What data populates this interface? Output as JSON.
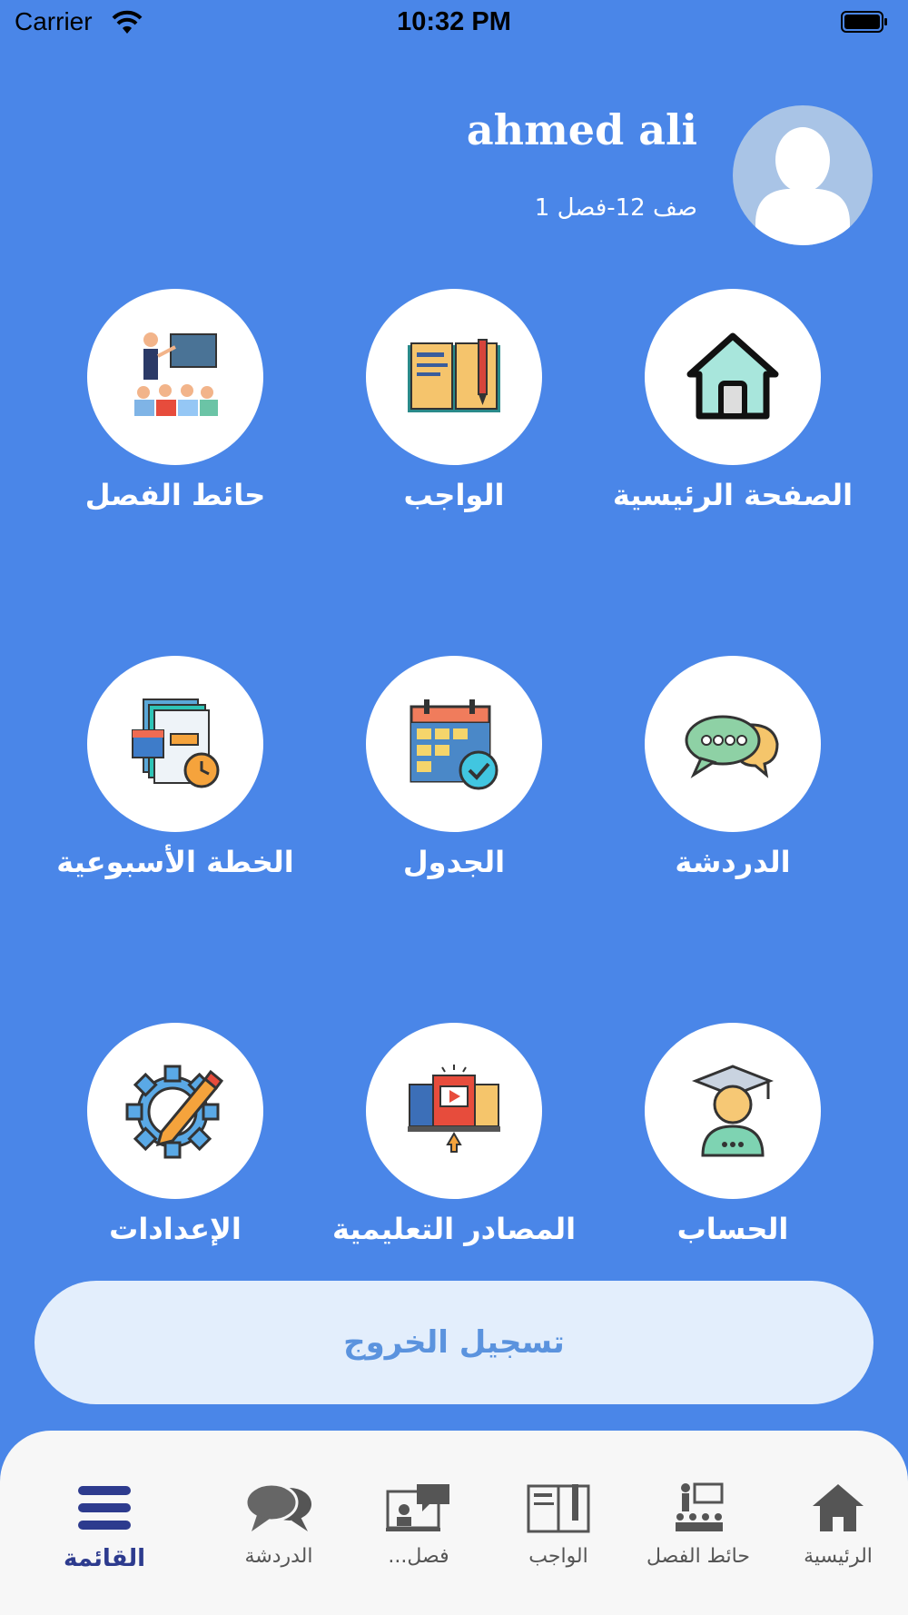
{
  "status": {
    "carrier": "Carrier",
    "time": "10:32 PM"
  },
  "profile": {
    "name": "ahmed ali",
    "class_info": "صف 12-فصل 1"
  },
  "tiles": [
    {
      "label": "الصفحة الرئيسية",
      "icon": "home-icon"
    },
    {
      "label": "الواجب",
      "icon": "homework-book-icon"
    },
    {
      "label": "حائط الفصل",
      "icon": "class-wall-icon"
    },
    {
      "label": "الدردشة",
      "icon": "chat-bubbles-icon"
    },
    {
      "label": "الجدول",
      "icon": "schedule-calendar-icon"
    },
    {
      "label": "الخطة الأسبوعية",
      "icon": "weekly-plan-icon"
    },
    {
      "label": "الحساب",
      "icon": "account-graduate-icon"
    },
    {
      "label": "المصادر التعليمية",
      "icon": "learning-resources-icon"
    },
    {
      "label": "الإعدادات",
      "icon": "settings-gear-icon"
    }
  ],
  "logout_label": "تسجيل الخروج",
  "tabbar": [
    {
      "label": "الرئيسية",
      "icon": "home-icon"
    },
    {
      "label": "حائط الفصل",
      "icon": "class-wall-icon"
    },
    {
      "label": "الواجب",
      "icon": "book-icon"
    },
    {
      "label": "فصل...",
      "icon": "virtual-class-icon"
    },
    {
      "label": "الدردشة",
      "icon": "chat-icon"
    },
    {
      "label": "القائمة",
      "icon": "menu-icon",
      "active": true
    }
  ],
  "colors": {
    "background": "#4a86e8",
    "logout_bg": "#e3eefc",
    "active_tab": "#2d3b8e"
  }
}
